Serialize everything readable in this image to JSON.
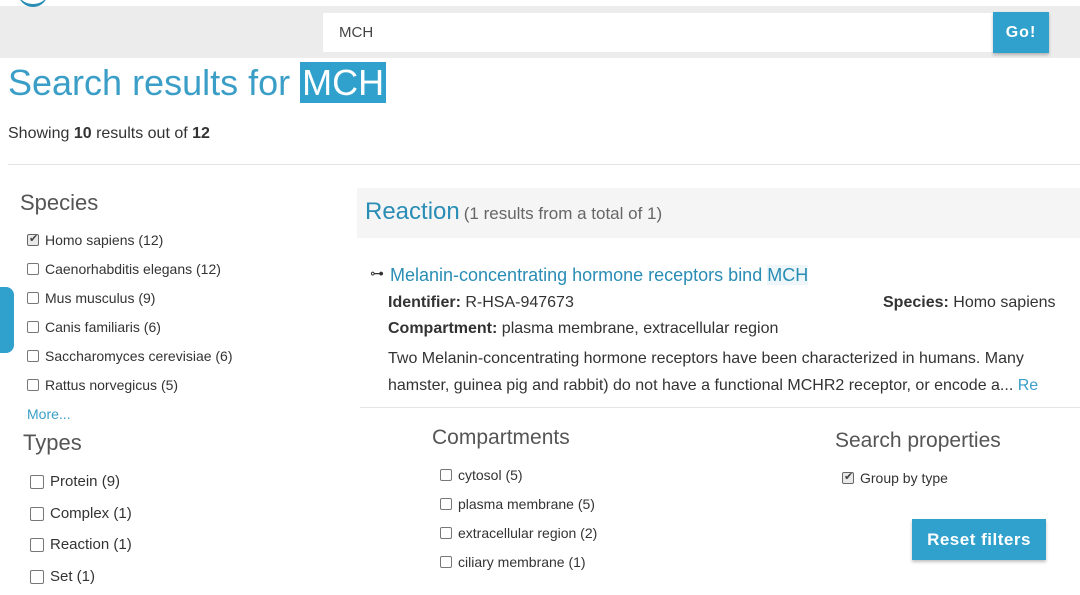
{
  "search": {
    "query": "MCH",
    "go_label": "Go!"
  },
  "title": {
    "prefix": "Search results for ",
    "highlight": "MCH"
  },
  "summary": {
    "showing": "Showing ",
    "count": "10",
    "middle": " results out of ",
    "total": "12"
  },
  "species": {
    "title": "Species",
    "items": [
      {
        "label": "Homo sapiens (12)",
        "checked": true
      },
      {
        "label": "Caenorhabditis elegans (12)",
        "checked": false
      },
      {
        "label": "Mus musculus (9)",
        "checked": false
      },
      {
        "label": "Canis familiaris (6)",
        "checked": false
      },
      {
        "label": "Saccharomyces cerevisiae (6)",
        "checked": false
      },
      {
        "label": "Rattus norvegicus (5)",
        "checked": false
      }
    ],
    "more": "More..."
  },
  "types": {
    "title": "Types",
    "items": [
      {
        "label": "Protein (9)",
        "checked": false
      },
      {
        "label": "Complex (1)",
        "checked": false
      },
      {
        "label": "Reaction (1)",
        "checked": false
      },
      {
        "label": "Set (1)",
        "checked": false
      }
    ]
  },
  "section": {
    "title": "Reaction",
    "subtitle": "(1 results from a total of 1)"
  },
  "result": {
    "title_prefix": "Melanin-concentrating hormone receptors bind ",
    "title_match": "MCH",
    "identifier_label": "Identifier:",
    "identifier": "R-HSA-947673",
    "species_label": "Species:",
    "species": "Homo sapiens",
    "compartment_label": "Compartment:",
    "compartment": "plasma membrane, extracellular region",
    "desc_line1": "Two Melanin-concentrating hormone receptors have been characterized in humans. Many",
    "desc_line2": "hamster, guinea pig and rabbit) do not have a functional MCHR2 receptor, or encode a...",
    "read_more": "Re"
  },
  "compartments": {
    "title": "Compartments",
    "items": [
      {
        "label": "cytosol (5)",
        "checked": false
      },
      {
        "label": "plasma membrane (5)",
        "checked": false
      },
      {
        "label": "extracellular region (2)",
        "checked": false
      },
      {
        "label": "ciliary membrane (1)",
        "checked": false
      }
    ]
  },
  "search_properties": {
    "title": "Search properties",
    "group_by_type": "Group by type",
    "group_by_type_checked": true,
    "reset_label": "Reset filters"
  }
}
